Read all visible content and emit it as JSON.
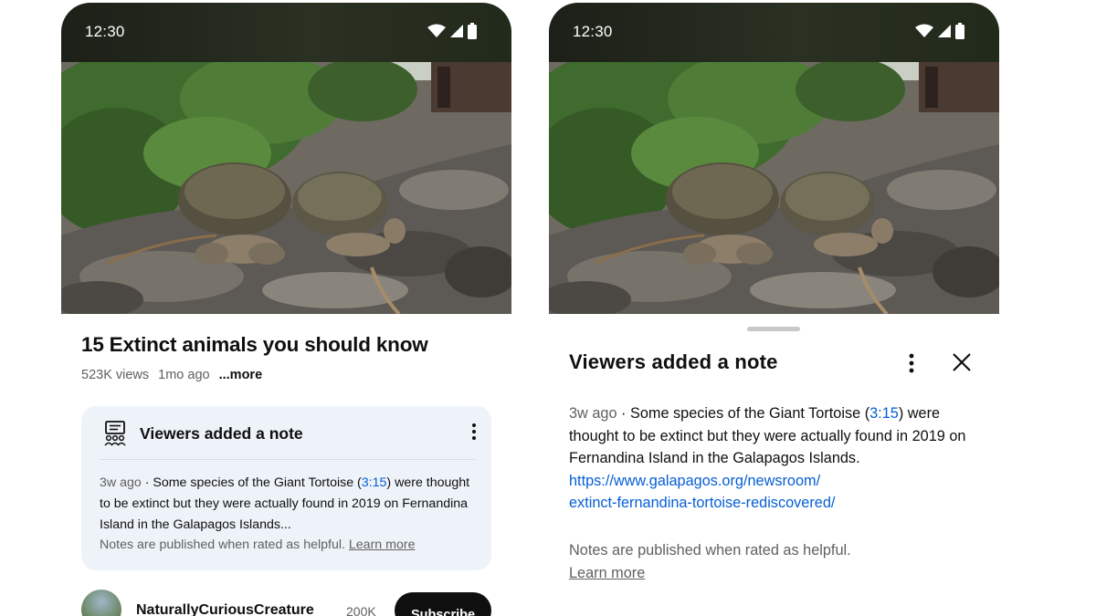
{
  "status_bar": {
    "time": "12:30"
  },
  "video": {
    "title": "15 Extinct animals you should know",
    "views": "523K views",
    "age": "1mo ago",
    "more": "...more"
  },
  "note_card": {
    "title": "Viewers added a note",
    "age": "3w ago",
    "text_before": "Some species of the Giant Tortoise (",
    "timestamp": "3:15",
    "text_after": ") were thought to be extinct but they were actually found in 2019 on Fernandina Island in the Galapagos Islands...",
    "footer": "Notes are published when rated as helpful.",
    "learn_more": "Learn more"
  },
  "channel": {
    "name": "NaturallyCuriousCreature",
    "subscribers": "200K",
    "subscribe_label": "Subscribe"
  },
  "sheet": {
    "title": "Viewers added a note",
    "age": "3w ago",
    "text_before": "Some species of the Giant Tortoise (",
    "timestamp": "3:15",
    "text_after": ") were thought to be extinct but they were actually found in 2019 on Fernandina Island in the Galapagos Islands.",
    "url_line1": "https://www.galapagos.org/newsroom/",
    "url_line2": "extinct-fernandina-tortoise-rediscovered/",
    "footer": "Notes are published when rated as helpful.",
    "learn_more": "Learn more"
  },
  "icons": [
    "wifi-icon",
    "cellular-signal-icon",
    "battery-icon",
    "community-notes-icon",
    "more-vert-icon",
    "close-icon"
  ],
  "colors": {
    "link": "#065fd4",
    "note_bg": "#eef3fa",
    "subscribe_bg": "#0f0f0f"
  }
}
